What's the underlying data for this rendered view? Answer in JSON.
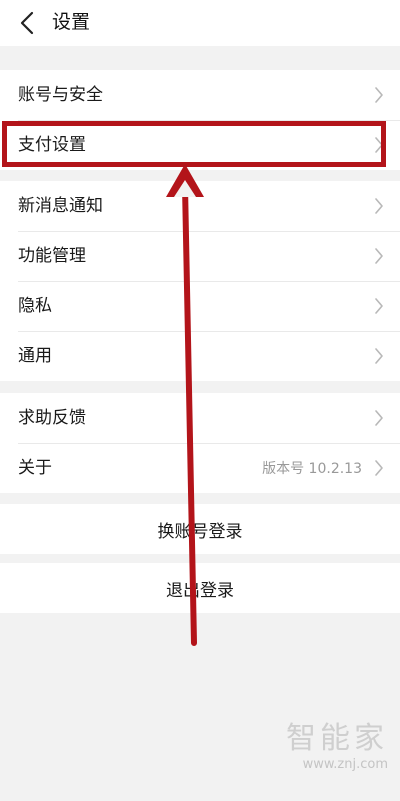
{
  "header": {
    "title": "设置",
    "back_icon": "back-chevron-icon"
  },
  "groups": [
    {
      "items": [
        {
          "label": "账号与安全"
        },
        {
          "label": "支付设置"
        }
      ]
    },
    {
      "items": [
        {
          "label": "新消息通知"
        },
        {
          "label": "功能管理"
        },
        {
          "label": "隐私"
        },
        {
          "label": "通用"
        }
      ]
    },
    {
      "items": [
        {
          "label": "求助反馈"
        },
        {
          "label": "关于",
          "value": "版本号 10.2.13"
        }
      ]
    }
  ],
  "actions": {
    "switch_account": "换账号登录",
    "logout": "退出登录"
  },
  "annotation": {
    "highlight_color": "#b3141a"
  },
  "watermark": {
    "title": "智能家",
    "url": "www.znj.com"
  }
}
